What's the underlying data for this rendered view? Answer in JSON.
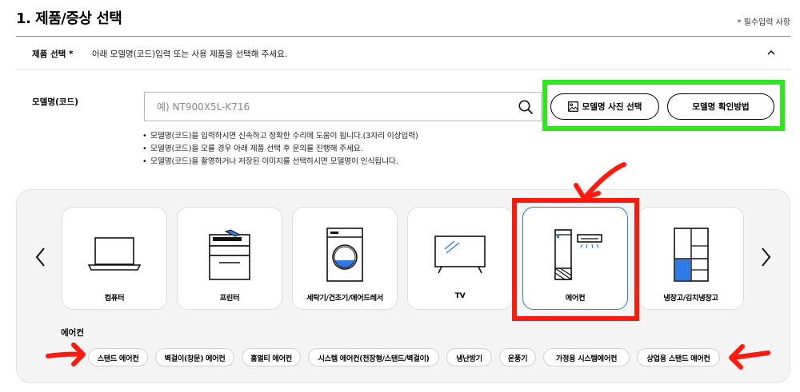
{
  "header": {
    "title": "1. 제품/증상 선택",
    "required_note": "* 필수입력 사항"
  },
  "product_select": {
    "label": "제품 선택 *",
    "description": "아래 모델명(코드)입력 또는 사용 제품을 선택해 주세요."
  },
  "model": {
    "label": "모델명(코드)",
    "search_placeholder": "예) NT900X5L-K716",
    "search_value": "",
    "photo_button_label": "모델명 사진 선택",
    "howto_button_label": "모델명 확인방법"
  },
  "tips": [
    "모델명(코드)을 입력하시면 신속하고 정확한 수리에 도움이 됩니다.(3자리 이상입력)",
    "모델명(코드)을 모를 경우 아래 제품 선택 후 문의를 진행해 주세요.",
    "모델명(코드)을 촬영하거나 저장된 이미지를 선택하시면 모델명이 인식됩니다."
  ],
  "categories": [
    {
      "label": "컴퓨터",
      "icon": "laptop-icon"
    },
    {
      "label": "프린터",
      "icon": "printer-icon"
    },
    {
      "label": "세탁기/건조기/에어드레서",
      "icon": "washing-machine-icon"
    },
    {
      "label": "TV",
      "icon": "tv-icon"
    },
    {
      "label": "에어컨",
      "icon": "air-conditioner-icon",
      "selected": true
    },
    {
      "label": "냉장고/김치냉장고",
      "icon": "refrigerator-icon"
    }
  ],
  "subcategory": {
    "title": "에어컨",
    "items": [
      "스탠드 에어컨",
      "벽걸이(창문) 에어컨",
      "홈멀티 에어컨",
      "시스템 에어컨(천장형/스탠드/벽걸이)",
      "냉난방기",
      "온풍기",
      "가정용 시스템에어컨",
      "상업용 스탠드 에어컨"
    ]
  },
  "colors": {
    "highlight_green": "#2fe71c",
    "highlight_red": "#ff1a0e",
    "selected_border": "#2a7ae2",
    "icon_blue": "#2f7be6"
  }
}
